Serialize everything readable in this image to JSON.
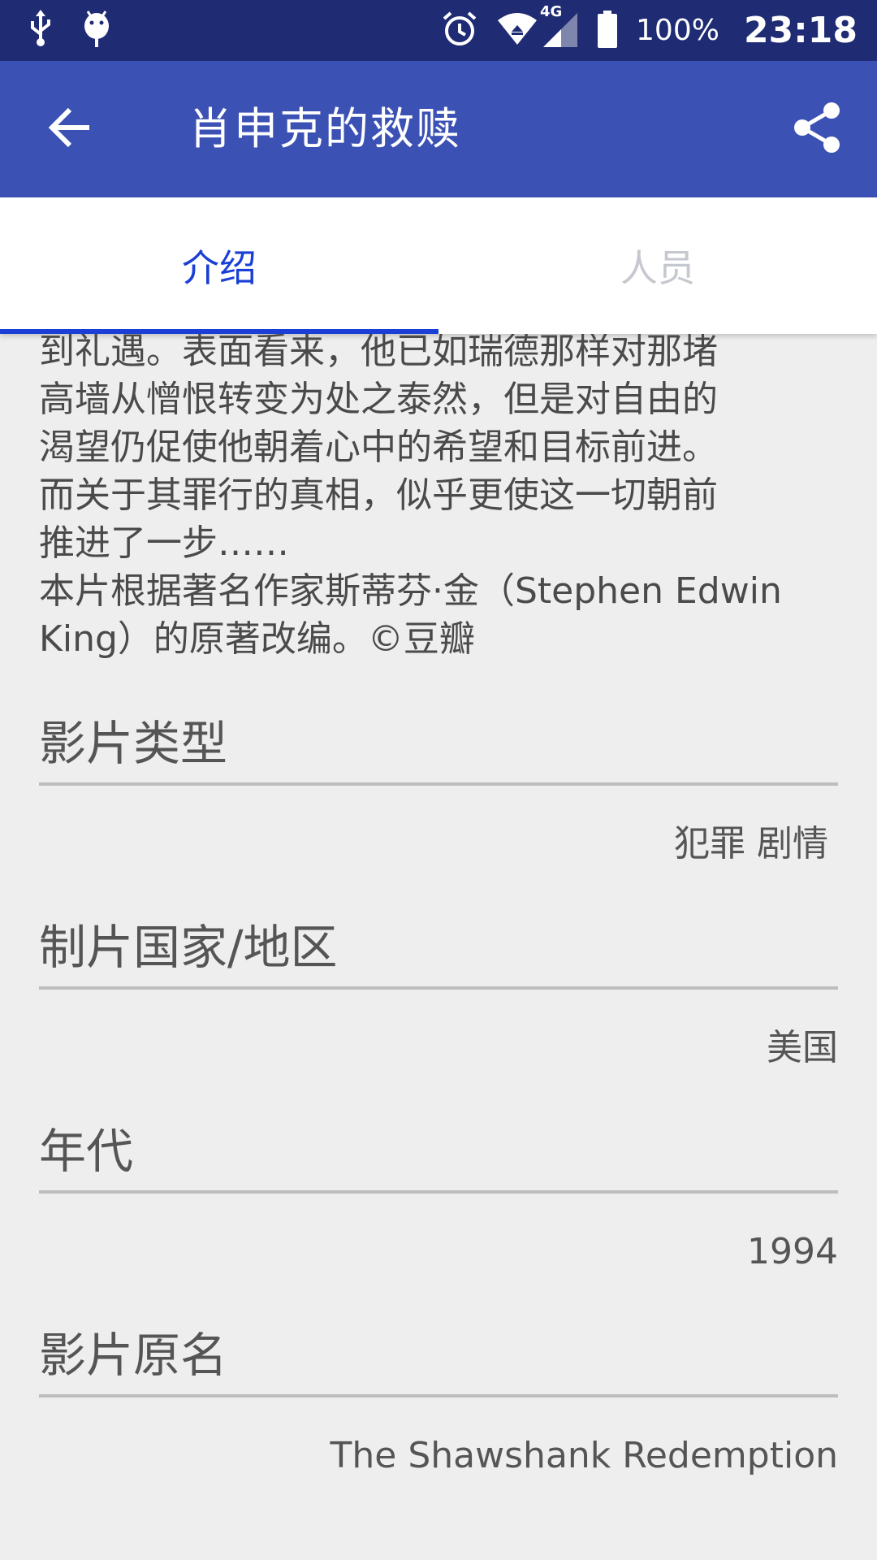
{
  "status_bar": {
    "icons_left": [
      "usb-icon",
      "android-debug-icon"
    ],
    "icons_right": [
      "alarm-icon",
      "wifi-icon",
      "4g-signal-icon",
      "battery-icon"
    ],
    "network_label": "4G",
    "battery": "100%",
    "time": "23:18"
  },
  "app_bar": {
    "title": "肖申克的救赎"
  },
  "tabs": [
    {
      "label": "介绍",
      "selected": true
    },
    {
      "label": "人员",
      "selected": false
    }
  ],
  "colors": {
    "status_bar": "#1f2b73",
    "app_bar": "#3b51b4",
    "tab_active": "#1a3fd6",
    "tab_inactive": "#c6c8cf",
    "background": "#eeeeee"
  },
  "synopsis": "到礼遇。表面看来，他已如瑞德那样对那堵\n高墙从憎恨转变为处之泰然，但是对自由的\n渴望仍促使他朝着心中的希望和目标前进。\n而关于其罪行的真相，似乎更使这一切朝前\n推进了一步……\n本片根据著名作家斯蒂芬·金（Stephen Edwin\nKing）的原著改编。©豆瓣",
  "sections": [
    {
      "title": "影片类型",
      "value": "犯罪 剧情"
    },
    {
      "title": "制片国家/地区",
      "value": "美国"
    },
    {
      "title": "年代",
      "value": "1994"
    },
    {
      "title": "影片原名",
      "value": "The Shawshank Redemption"
    }
  ]
}
